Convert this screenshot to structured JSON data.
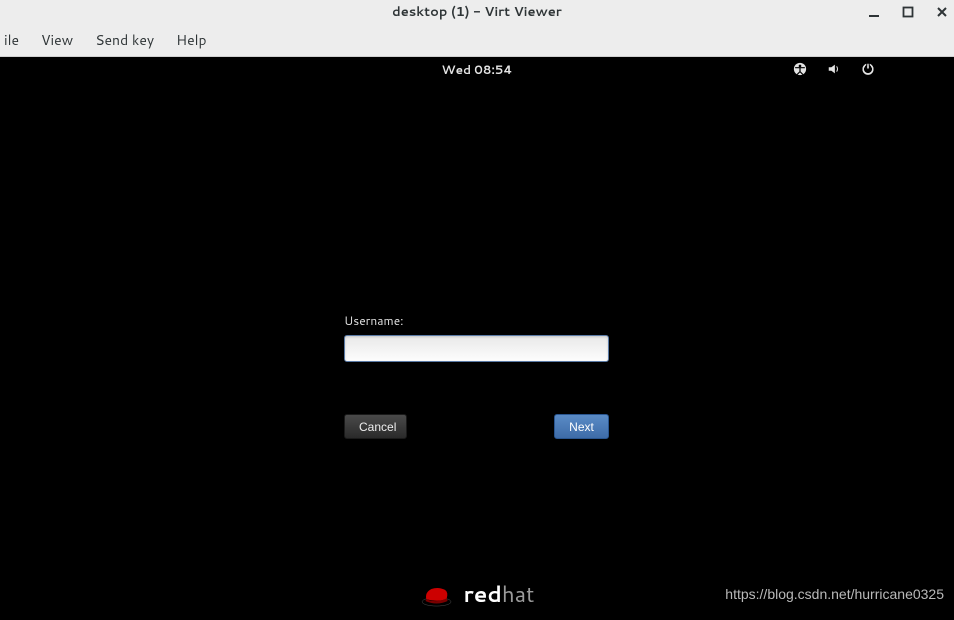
{
  "window": {
    "title": "desktop (1) - Virt Viewer"
  },
  "menubar": {
    "file": "ile",
    "view": "View",
    "sendkey": "Send key",
    "help": "Help"
  },
  "topbar": {
    "clock": "Wed 08:54"
  },
  "login": {
    "username_label": "Username:",
    "username_value": "",
    "cancel_label": "Cancel",
    "next_label": "Next"
  },
  "branding": {
    "vendor_bold": "red",
    "vendor_light": "hat"
  },
  "watermark": {
    "text": "https://blog.csdn.net/hurricane0325"
  }
}
